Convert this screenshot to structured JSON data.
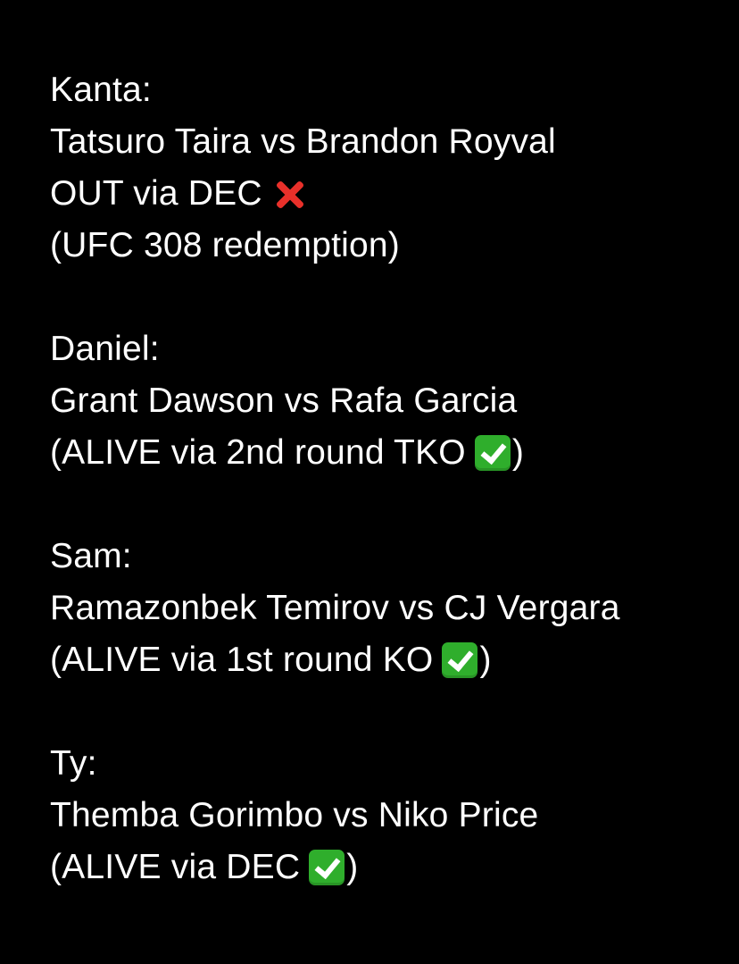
{
  "colors": {
    "background": "#000000",
    "text": "#ffffff",
    "cross": "#e8302a",
    "check": "#2fae2c"
  },
  "picks": [
    {
      "name": "Kanta:",
      "matchup": "Tatsuro Taira vs Brandon Royval",
      "result": "OUT via DEC",
      "result_icon": "cross-mark-icon",
      "note": "(UFC 308 redemption)"
    },
    {
      "name": "Daniel:",
      "matchup": "Grant Dawson vs Rafa Garcia",
      "result_open": "(ALIVE via 2nd round TKO",
      "result_icon": "check-mark-icon",
      "result_close": ")"
    },
    {
      "name": "Sam:",
      "matchup": "Ramazonbek Temirov vs CJ Vergara",
      "result_open": "(ALIVE via 1st round KO",
      "result_icon": "check-mark-icon",
      "result_close": ")"
    },
    {
      "name": "Ty:",
      "matchup": "Themba Gorimbo vs Niko Price",
      "result_open": "(ALIVE via DEC",
      "result_icon": "check-mark-icon",
      "result_close": ")"
    }
  ]
}
